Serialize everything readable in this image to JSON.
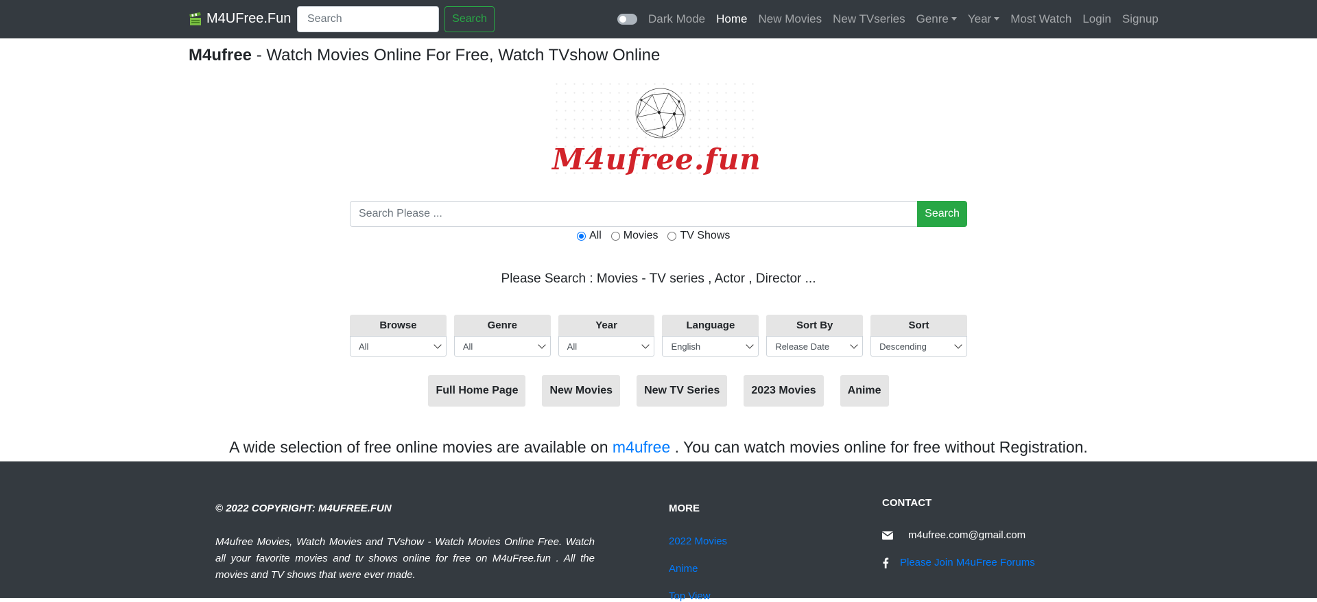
{
  "navbar": {
    "brand": "M4UFree.Fun",
    "search_placeholder": "Search",
    "search_button": "Search",
    "dark_mode_label": "Dark Mode",
    "links": {
      "home": "Home",
      "new_movies": "New Movies",
      "new_tvseries": "New TVseries",
      "genre": "Genre",
      "year": "Year",
      "most_watch": "Most Watch",
      "login": "Login",
      "signup": "Signup"
    }
  },
  "header": {
    "title_bold": "M4ufree",
    "title_rest": " - Watch Movies Online For Free, Watch TVshow Online"
  },
  "logo": {
    "text": "M4ufree.fun",
    "color": "#d2232a"
  },
  "search": {
    "placeholder": "Search Please ...",
    "button": "Search",
    "options": [
      {
        "label": "All",
        "checked": true
      },
      {
        "label": "Movies",
        "checked": false
      },
      {
        "label": "TV Shows",
        "checked": false
      }
    ],
    "hint": "Please Search : Movies - TV series , Actor , Director ..."
  },
  "filters": [
    {
      "label": "Browse",
      "value": "All"
    },
    {
      "label": "Genre",
      "value": "All"
    },
    {
      "label": "Year",
      "value": "All"
    },
    {
      "label": "Language",
      "value": "English"
    },
    {
      "label": "Sort By",
      "value": "Release Date"
    },
    {
      "label": "Sort",
      "value": "Descending"
    }
  ],
  "quick_buttons": [
    "Full Home Page",
    "New Movies",
    "New TV Series",
    "2023 Movies",
    "Anime"
  ],
  "tagline": {
    "before": "A wide selection of free online movies are available on ",
    "link": "m4ufree",
    "after": " . You can watch movies online for free without Registration."
  },
  "footer": {
    "copyright": "© 2022 COPYRIGHT: M4UFREE.FUN",
    "about": "M4ufree Movies, Watch Movies and TVshow - Watch Movies Online Free. Watch all your favorite movies and tv shows online for free on M4uFree.fun . All the movies and TV shows that were ever made.",
    "more_title": "MORE",
    "more_links": [
      "2022 Movies",
      "Anime",
      "Top View"
    ],
    "contact_title": "CONTACT",
    "email": "m4ufree.com@gmail.com",
    "forum_link": "Please Join M4uFree Forums"
  },
  "colors": {
    "navbar_bg": "#343a40",
    "accent_green": "#28a745",
    "link_blue": "#007bff",
    "logo_red": "#d2232a"
  }
}
